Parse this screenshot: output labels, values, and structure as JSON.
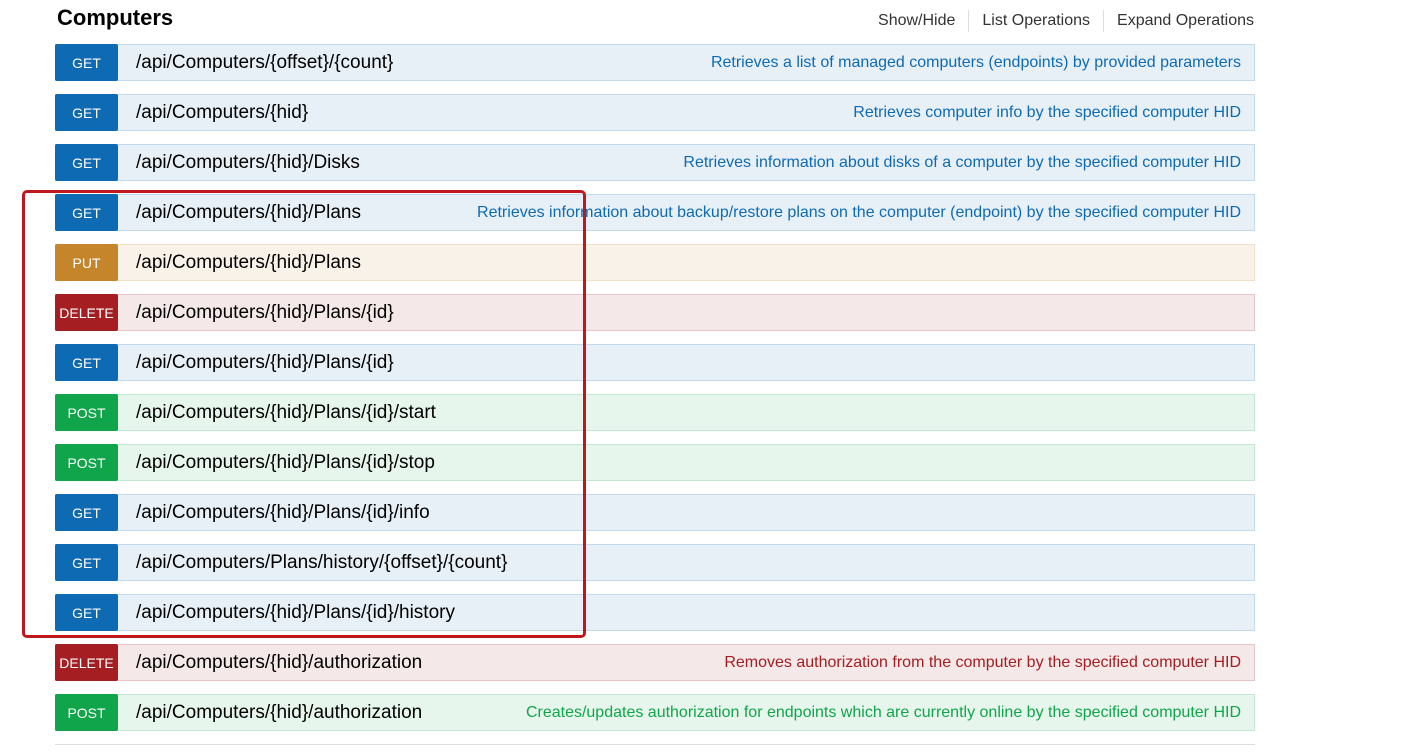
{
  "section": {
    "title": "Computers",
    "actions": [
      "Show/Hide",
      "List Operations",
      "Expand Operations"
    ]
  },
  "endpoints": [
    {
      "method": "GET",
      "type": "get",
      "path": "/api/Computers/{offset}/{count}",
      "description": "Retrieves a list of managed computers (endpoints) by provided parameters"
    },
    {
      "method": "GET",
      "type": "get",
      "path": "/api/Computers/{hid}",
      "description": "Retrieves computer info by the specified computer HID"
    },
    {
      "method": "GET",
      "type": "get",
      "path": "/api/Computers/{hid}/Disks",
      "description": "Retrieves information about disks of a computer by the specified computer HID"
    },
    {
      "method": "GET",
      "type": "get",
      "path": "/api/Computers/{hid}/Plans",
      "description": "Retrieves information about backup/restore plans on the computer (endpoint) by the specified computer HID"
    },
    {
      "method": "PUT",
      "type": "put",
      "path": "/api/Computers/{hid}/Plans",
      "description": ""
    },
    {
      "method": "DELETE",
      "type": "delete",
      "path": "/api/Computers/{hid}/Plans/{id}",
      "description": ""
    },
    {
      "method": "GET",
      "type": "get",
      "path": "/api/Computers/{hid}/Plans/{id}",
      "description": ""
    },
    {
      "method": "POST",
      "type": "post",
      "path": "/api/Computers/{hid}/Plans/{id}/start",
      "description": ""
    },
    {
      "method": "POST",
      "type": "post",
      "path": "/api/Computers/{hid}/Plans/{id}/stop",
      "description": ""
    },
    {
      "method": "GET",
      "type": "get",
      "path": "/api/Computers/{hid}/Plans/{id}/info",
      "description": ""
    },
    {
      "method": "GET",
      "type": "get",
      "path": "/api/Computers/Plans/history/{offset}/{count}",
      "description": ""
    },
    {
      "method": "GET",
      "type": "get",
      "path": "/api/Computers/{hid}/Plans/{id}/history",
      "description": ""
    },
    {
      "method": "DELETE",
      "type": "delete",
      "path": "/api/Computers/{hid}/authorization",
      "description": "Removes authorization from the computer by the specified computer HID"
    },
    {
      "method": "POST",
      "type": "post",
      "path": "/api/Computers/{hid}/authorization",
      "description": "Creates/updates authorization for endpoints which are currently online by the specified computer HID"
    }
  ],
  "colors": {
    "get": "#0f6ab4",
    "put": "#c5862b",
    "delete": "#a41e22",
    "post": "#10a54a",
    "highlight": "#c0171e"
  }
}
